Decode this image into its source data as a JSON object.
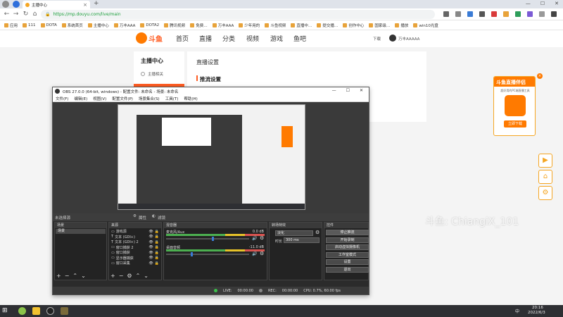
{
  "browser": {
    "tabs": [
      {
        "label": "主播中心",
        "close": "×"
      }
    ],
    "new_tab": "+",
    "url": "https://mp.douyu.com/live/main",
    "bookmarks": [
      "应用",
      "111",
      "DOTA",
      "系统首页",
      "主播中心",
      "万丰AAA",
      "DOTA2",
      "腾讯视频",
      "免费…",
      "万丰AAA",
      "少年用的",
      "斗鱼视频",
      "直播中…",
      "提交播…",
      "创作中心",
      "国家级…",
      "播放",
      "win10光盘"
    ]
  },
  "site": {
    "logo": "斗鱼",
    "nav": [
      "首页",
      "直播",
      "分类",
      "视频",
      "游戏",
      "鱼吧"
    ],
    "download": "下载",
    "username": "万丰AAAAA",
    "sidebar_title": "主播中心",
    "sidebar_item": "主播相关",
    "content_title": "直播设置",
    "section_title": "推流设置"
  },
  "promo": {
    "title": "斗鱼直播伴侣",
    "subtitle": "超好用的PC端直播工具",
    "cta": "立即下载"
  },
  "watermark": "斗鱼: ChiangiX_101",
  "obs": {
    "title": "OBS 27.0.0 (64-bit, windows) - 配置文件: 未命名 - 场景: 未命名",
    "menu": [
      "文件(F)",
      "编辑(E)",
      "视图(V)",
      "配置文件(P)",
      "场景集合(S)",
      "工具(T)",
      "帮助(H)"
    ],
    "no_source": "未选择源",
    "props": "属性",
    "filters": "滤镜",
    "docks": {
      "scenes": "场景",
      "sources": "来源",
      "mixer": "混音器",
      "transitions": "转场特效",
      "controls": "控件"
    },
    "scenes": [
      "场景"
    ],
    "sources": [
      "游戏源",
      "文本 (GDI+)",
      "文本 (GDI+) 2",
      "窗口捕获 2",
      "窗口捕获",
      "显示器捕获",
      "窗口采集"
    ],
    "mixer": [
      {
        "name": "麦克风/Aux",
        "db": "0.0 dB",
        "level": 0.55
      },
      {
        "name": "桌面音频",
        "db": "-11.0 dB",
        "level": 0.3
      }
    ],
    "transition": {
      "type": "淡化",
      "duration_label": "时长",
      "duration": "300 ms"
    },
    "controls": [
      "停止推流",
      "开始录制",
      "启动虚拟摄像机",
      "工作室模式",
      "设置",
      "退出"
    ],
    "status": {
      "live_label": "LIVE:",
      "live_time": "00:00:00",
      "rec_label": "REC:",
      "rec_time": "00:00:00",
      "cpu": "CPU: 0.7%, 60.00 fps"
    }
  },
  "taskbar": {
    "time": "20:16",
    "date": "2022/6/3",
    "lang": "中"
  }
}
